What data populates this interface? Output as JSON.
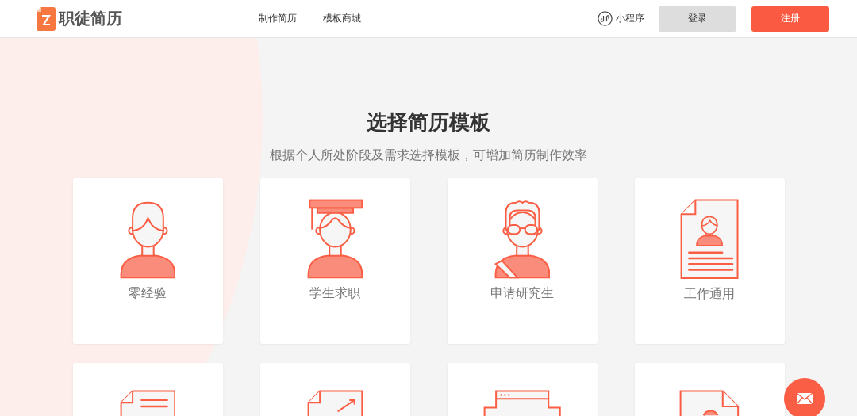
{
  "header": {
    "logo_text": "职徒简历",
    "nav": [
      {
        "label": "制作简历"
      },
      {
        "label": "模板商城"
      }
    ],
    "mini_program": "小程序",
    "login_button": "登录",
    "register_button": "注册"
  },
  "hero": {
    "title": "选择简历模板",
    "subtitle": "根据个人所处阶段及需求选择模板，可增加简历制作效率"
  },
  "templates": [
    {
      "kind": "person",
      "label": "零经验"
    },
    {
      "kind": "graduate",
      "label": "学生求职"
    },
    {
      "kind": "researcher",
      "label": "申请研究生"
    },
    {
      "kind": "resume-doc",
      "label": "工作通用"
    },
    {
      "kind": "letter-doc"
    },
    {
      "kind": "chart-doc"
    },
    {
      "kind": "browser"
    },
    {
      "kind": "video-doc"
    }
  ]
}
